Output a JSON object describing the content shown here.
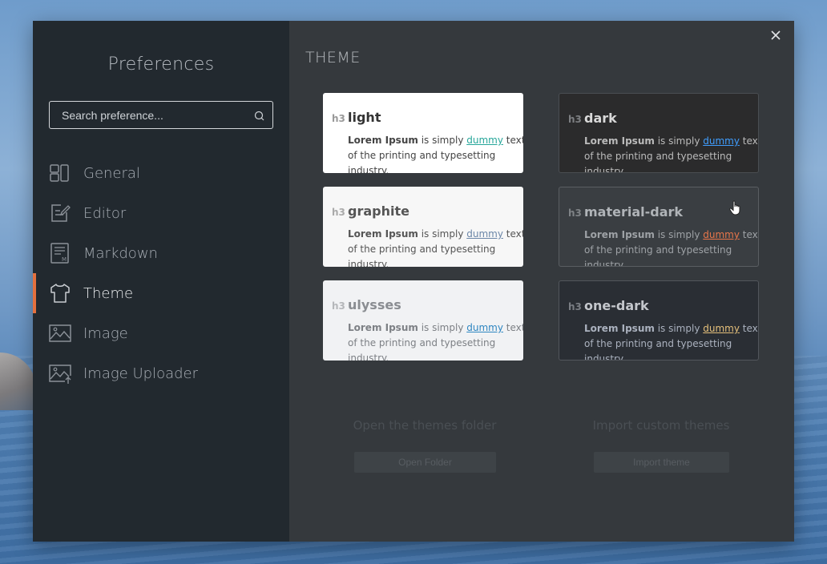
{
  "app": {
    "sidebar_title": "Preferences",
    "search_placeholder": "Search preference...",
    "accent_color": "#e4703e"
  },
  "sidebar": {
    "items": [
      {
        "label": "General",
        "icon": "layout-icon",
        "active": false
      },
      {
        "label": "Editor",
        "icon": "edit-icon",
        "active": false
      },
      {
        "label": "Markdown",
        "icon": "markdown-icon",
        "active": false
      },
      {
        "label": "Theme",
        "icon": "shirt-icon",
        "active": true
      },
      {
        "label": "Image",
        "icon": "image-icon",
        "active": false
      },
      {
        "label": "Image Uploader",
        "icon": "image-upload-icon",
        "active": false
      }
    ]
  },
  "main": {
    "section_title": "THEME",
    "themes": [
      {
        "name": "light",
        "tag": "h3",
        "bold": "Lorem Ipsum",
        "text1": " is simply ",
        "link": "dummy",
        "text2": " text of the printing and typesetting industry."
      },
      {
        "name": "dark",
        "tag": "h3",
        "bold": "Lorem Ipsum",
        "text1": " is simply ",
        "link": "dummy",
        "text2": " text of the printing and typesetting industry."
      },
      {
        "name": "graphite",
        "tag": "h3",
        "bold": "Lorem Ipsum",
        "text1": " is simply ",
        "link": "dummy",
        "text2": " text of the printing and typesetting industry."
      },
      {
        "name": "material-dark",
        "tag": "h3",
        "bold": "Lorem Ipsum",
        "text1": " is simply ",
        "link": "dummy",
        "text2": " text of the printing and typesetting industry."
      },
      {
        "name": "ulysses",
        "tag": "h3",
        "bold": "Lorem Ipsum",
        "text1": " is simply ",
        "link": "dummy",
        "text2": " text of the printing and typesetting industry."
      },
      {
        "name": "one-dark",
        "tag": "h3",
        "bold": "Lorem Ipsum",
        "text1": " is simply ",
        "link": "dummy",
        "text2": " text of the printing and typesetting industry."
      }
    ],
    "open_folder_label": "Open the themes folder",
    "open_folder_button": "Open Folder",
    "import_label": "Import custom themes",
    "import_button": "Import theme"
  }
}
